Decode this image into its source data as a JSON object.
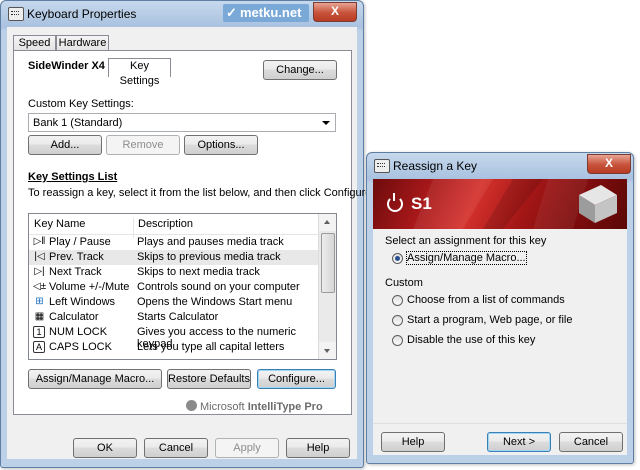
{
  "kb": {
    "title": "Keyboard Properties",
    "watermark": "metku.net",
    "close": "X",
    "tabs": [
      {
        "label": "Speed"
      },
      {
        "label": "Hardware"
      },
      {
        "label": "Key Settings"
      }
    ],
    "device_name": "SideWinder X4 Keyboard",
    "change_btn": "Change...",
    "custom_label": "Custom Key Settings:",
    "bank_value": "Bank 1 (Standard)",
    "add_btn": "Add...",
    "remove_btn": "Remove",
    "options_btn": "Options...",
    "list_title": "Key Settings List",
    "list_instr": "To reassign a key, select it from the list below, and then click Configure.",
    "col_name": "Key Name",
    "col_desc": "Description",
    "rows": [
      {
        "icon": "▷‖",
        "name": "Play / Pause",
        "desc": "Plays and pauses media track"
      },
      {
        "icon": "|◁",
        "name": "Prev. Track",
        "desc": "Skips to previous media track"
      },
      {
        "icon": "▷|",
        "name": "Next Track",
        "desc": "Skips to next media track"
      },
      {
        "icon": "◁±",
        "name": "Volume +/-/Mute",
        "desc": "Controls sound on your computer"
      },
      {
        "icon": "⊞",
        "name": "Left Windows",
        "desc": "Opens the Windows Start menu"
      },
      {
        "icon": "▦",
        "name": "Calculator",
        "desc": "Starts Calculator"
      },
      {
        "icon": "1",
        "name": "NUM LOCK",
        "desc": "Gives you access to the numeric keypad"
      },
      {
        "icon": "A",
        "name": "CAPS LOCK",
        "desc": "Lets you type all capital letters"
      }
    ],
    "assign_btn": "Assign/Manage Macro...",
    "restore_btn": "Restore Defaults",
    "configure_btn": "Configure...",
    "brand_ms": "Microsoft",
    "brand_it": "IntelliType Pro",
    "ok_btn": "OK",
    "cancel_btn": "Cancel",
    "apply_btn": "Apply",
    "help_btn": "Help"
  },
  "ra": {
    "title": "Reassign a Key",
    "close": "X",
    "key_name": "S1",
    "select_label": "Select an assignment for this key",
    "opt_macro": "Assign/Manage Macro...",
    "custom_label": "Custom",
    "opt_commands": "Choose from a list of commands",
    "opt_program": "Start a program, Web page, or file",
    "opt_disable": "Disable the use of this key",
    "help_btn": "Help",
    "next_btn": "Next >",
    "cancel_btn": "Cancel"
  },
  "colors": {
    "banner": "#b31f1f",
    "titlebar": "#b9cfe8",
    "close": "#c7523a"
  }
}
